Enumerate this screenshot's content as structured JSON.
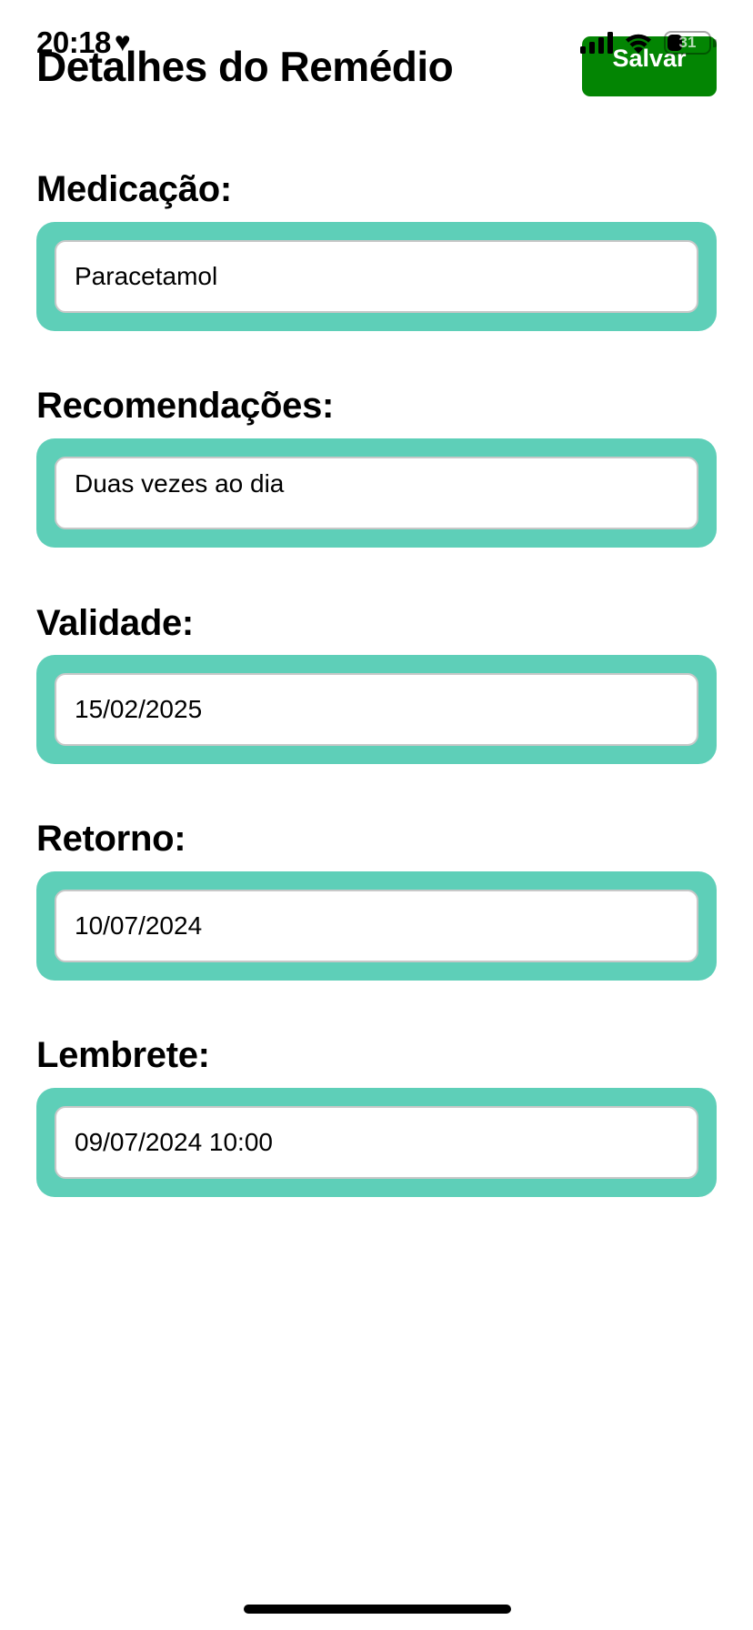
{
  "status_bar": {
    "time": "20:18",
    "heart": "♥",
    "icons": [
      "cellular-signal-icon",
      "wifi-icon",
      "battery-icon"
    ],
    "battery_level": "31"
  },
  "header": {
    "title": "Detalhes do Remédio",
    "save_label": "Salvar",
    "save_color": "#038503"
  },
  "form": {
    "accent_color": "#5ecfb8",
    "fields": [
      {
        "label": "Medicação:",
        "value": "Paracetamol"
      },
      {
        "label": "Recomendações:",
        "value": "Duas vezes ao dia"
      },
      {
        "label": "Validade:",
        "value": "15/02/2025"
      },
      {
        "label": "Retorno:",
        "value": "10/07/2024"
      },
      {
        "label": "Lembrete:",
        "value": "09/07/2024 10:00"
      }
    ]
  }
}
